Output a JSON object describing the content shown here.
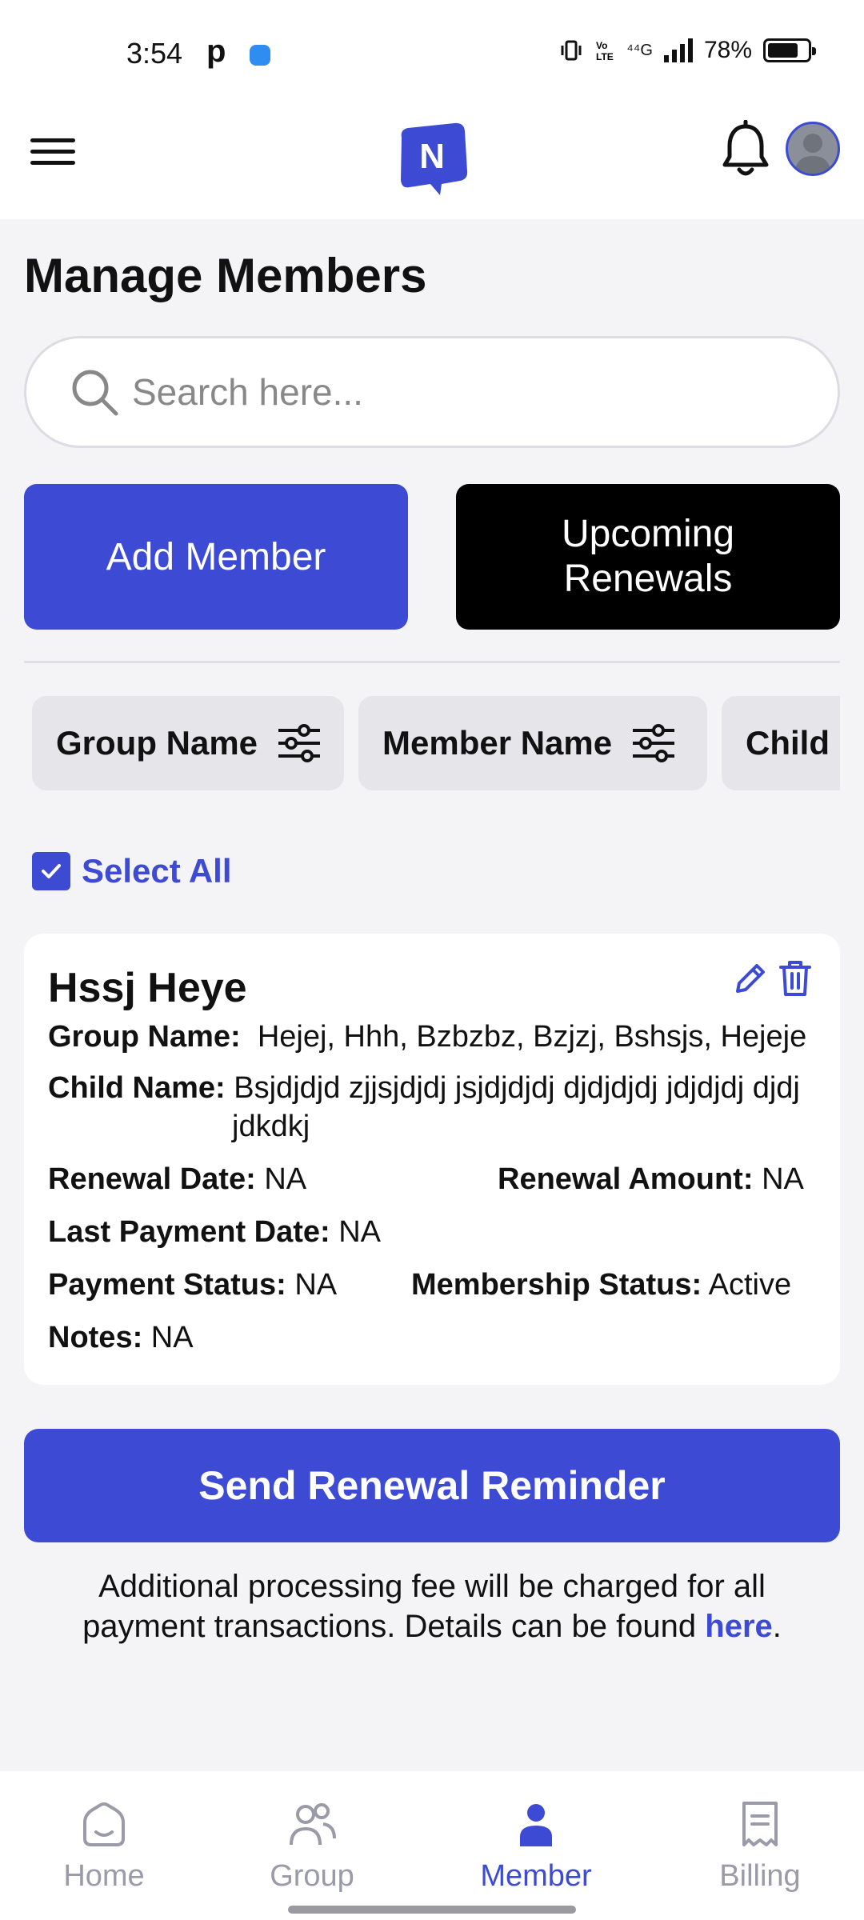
{
  "status_bar": {
    "time": "3:54",
    "app_letter": "p",
    "network": "⁴⁴G",
    "battery": "78%",
    "battery_level": 0.78
  },
  "header": {
    "logo_letter": "N",
    "brand_color": "#3d4bd4"
  },
  "page": {
    "title": "Manage Members"
  },
  "search": {
    "placeholder": "Search here..."
  },
  "actions": {
    "add_member": "Add Member",
    "upcoming_renewals": "Upcoming Renewals"
  },
  "filters": [
    {
      "label": "Group Name"
    },
    {
      "label": "Member Name"
    },
    {
      "label": "Child Name"
    }
  ],
  "select_all": {
    "label": "Select All",
    "checked": true
  },
  "member": {
    "name": "Hssj Heye",
    "group_name_label": "Group Name:",
    "group_name": "Hejej, Hhh, Bzbzbz, Bzjzj, Bshsjs, Hejeje",
    "child_name_label": "Child Name:",
    "child_name": "Bsjdjdjd zjjsjdjdj jsjdjdjdj djdjdjdj jdjdjdj djdj",
    "child_name_cont": "jdkdkj",
    "renewal_date_label": "Renewal Date:",
    "renewal_date": "NA",
    "renewal_amount_label": "Renewal Amount:",
    "renewal_amount": "NA",
    "last_payment_label": "Last Payment Date:",
    "last_payment": "NA",
    "payment_status_label": "Payment Status:",
    "payment_status": "NA",
    "membership_status_label": "Membership Status:",
    "membership_status": "Active",
    "notes_label": "Notes:",
    "notes": "NA"
  },
  "reminder": {
    "button": "Send Renewal Reminder",
    "note": "Additional processing fee will be charged for all payment transactions. Details can be found ",
    "link": "here",
    "note_end": "."
  },
  "bottom_nav": {
    "items": [
      {
        "label": "Home",
        "icon": "home-icon",
        "active": false
      },
      {
        "label": "Group",
        "icon": "group-icon",
        "active": false
      },
      {
        "label": "Member",
        "icon": "member-icon",
        "active": true
      },
      {
        "label": "Billing",
        "icon": "billing-icon",
        "active": false
      }
    ],
    "active_color": "#3d4bd4",
    "inactive_color": "#9a9aa8"
  }
}
